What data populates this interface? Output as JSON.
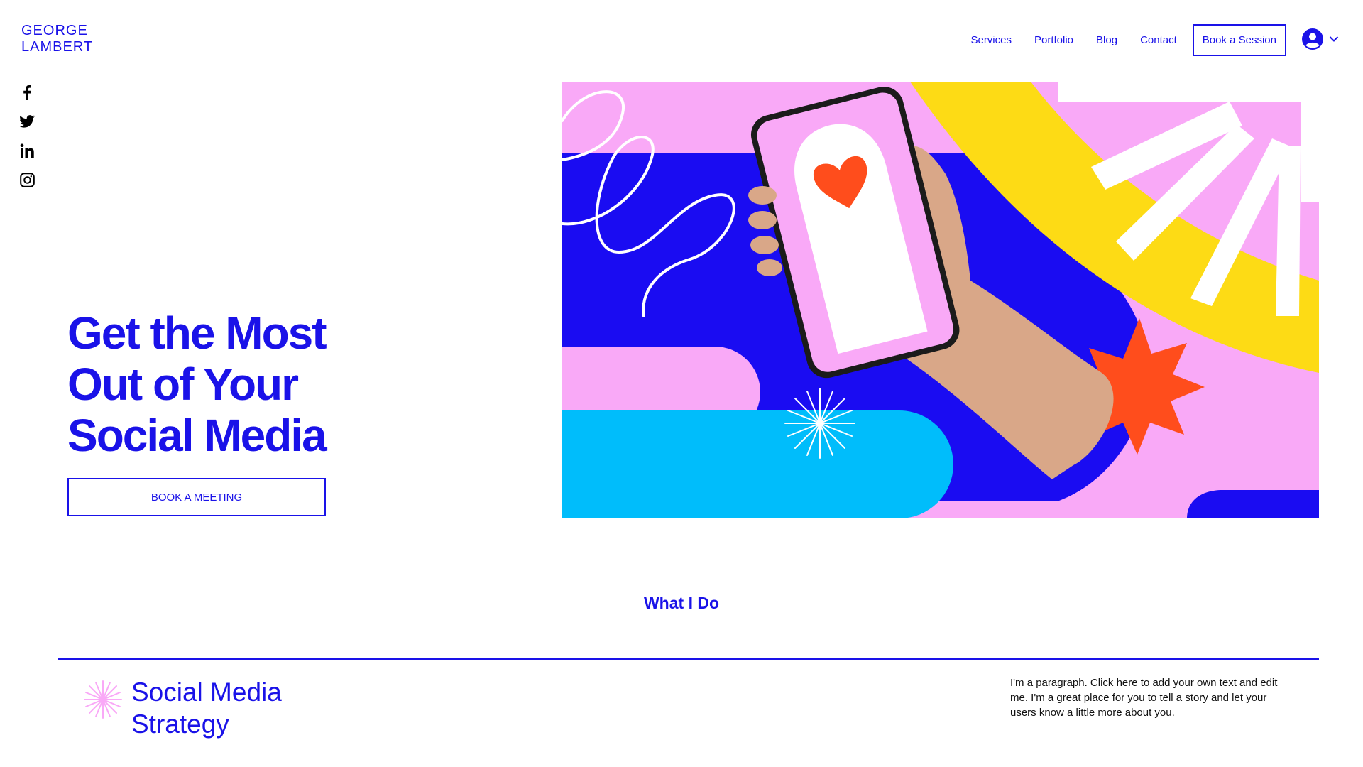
{
  "brand": {
    "line1": "GEORGE",
    "line2": "LAMBERT"
  },
  "nav": {
    "items": [
      {
        "label": "Services"
      },
      {
        "label": "Portfolio"
      },
      {
        "label": "Blog"
      },
      {
        "label": "Contact"
      }
    ],
    "cta_label": "Book a Session"
  },
  "account": {
    "icon": "user-avatar-icon",
    "chevron": "chevron-down-icon"
  },
  "social": [
    "facebook-icon",
    "twitter-icon",
    "linkedin-icon",
    "instagram-icon"
  ],
  "hero": {
    "title_line1": "Get the Most",
    "title_line2": "Out of Your",
    "title_line3": "Social Media",
    "button_label": "BOOK A MEETING"
  },
  "section": {
    "title": "What I Do",
    "service": {
      "title_line1": "Social Media",
      "title_line2": "Strategy",
      "text": "I'm a paragraph. Click here to add your own text and edit me. I'm a great place for you to tell a story and let your users know a little more about you."
    }
  },
  "colors": {
    "accent": "#1a12e8",
    "pink": "#f9a9f7",
    "yellow": "#fddb15",
    "cyan": "#00bdfb",
    "orange": "#ff4d1c"
  }
}
